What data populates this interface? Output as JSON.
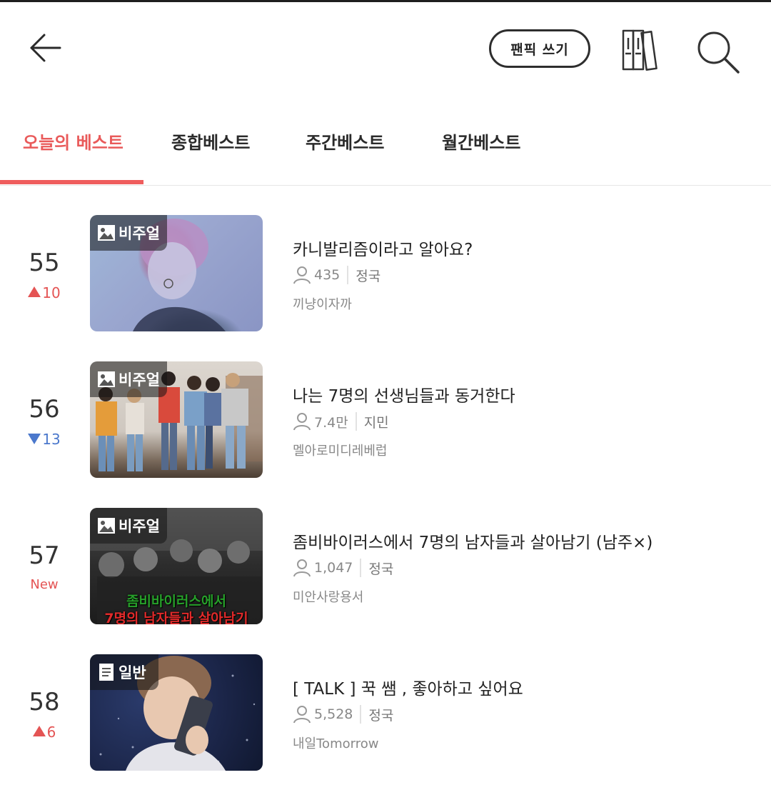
{
  "header": {
    "write_label": "팬픽 쓰기"
  },
  "tabs": [
    {
      "label": "오늘의 베스트",
      "active": true
    },
    {
      "label": "종합베스트"
    },
    {
      "label": "주간베스트"
    },
    {
      "label": "월간베스트"
    }
  ],
  "colors": {
    "accent": "#ef5d5d",
    "up": "#e45454",
    "down": "#4b78cc"
  },
  "items": [
    {
      "rank": "55",
      "delta": "10",
      "delta_dir": "up",
      "category": "비주얼",
      "category_icon": "image-icon",
      "title": "카니발리즘이라고 알아요?",
      "readers": "435",
      "member": "정국",
      "author": "끼냥이자까"
    },
    {
      "rank": "56",
      "delta": "13",
      "delta_dir": "down",
      "category": "비주얼",
      "category_icon": "image-icon",
      "title": "나는 7명의 선생님들과 동거한다",
      "readers": "7.4만",
      "member": "지민",
      "author": "멜아로미디레베럽"
    },
    {
      "rank": "57",
      "delta": "New",
      "delta_dir": "new",
      "category": "비주얼",
      "category_icon": "image-icon",
      "title": "좀비바이러스에서 7명의 남자들과 살아남기 (남주×)",
      "readers": "1,047",
      "member": "정국",
      "author": "미안사랑용서",
      "thumb_caption_1": "좀비바이러스에서",
      "thumb_caption_2": "7명의 남자들과 살아남기"
    },
    {
      "rank": "58",
      "delta": "6",
      "delta_dir": "up",
      "category": "일반",
      "category_icon": "document-icon",
      "title": "[ TALK ] 꾹 쌤 , 좋아하고 싶어요",
      "readers": "5,528",
      "member": "정국",
      "author": "내일Tomorrow"
    }
  ]
}
